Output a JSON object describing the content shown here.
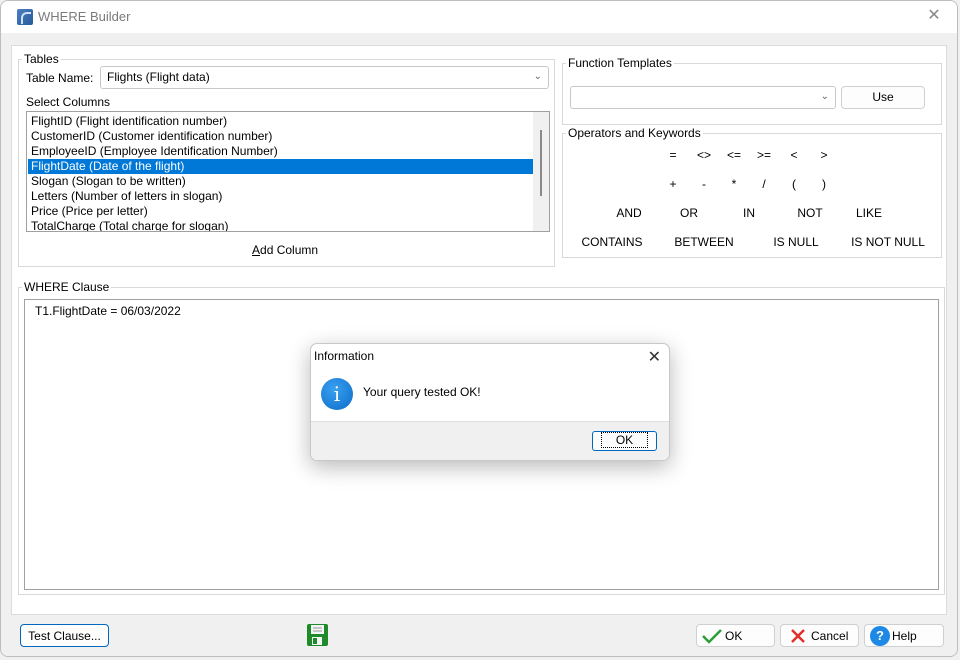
{
  "window": {
    "title": "WHERE Builder",
    "close_icon": "close-icon"
  },
  "tables": {
    "group_label": "Tables",
    "table_name_label": "Table Name:",
    "table_name_value": "Flights  (Flight data)",
    "select_columns_label": "Select Columns",
    "columns": [
      "FlightID  (Flight identification number)",
      "CustomerID  (Customer identification number)",
      "EmployeeID  (Employee Identification Number)",
      "FlightDate  (Date of the flight)",
      "Slogan  (Slogan to be written)",
      "Letters  (Number of letters in slogan)",
      "Price  (Price per letter)",
      "TotalCharge  (Total charge for slogan)"
    ],
    "selected_column": "FlightDate  (Date of the flight)",
    "add_column_label": "Add Column"
  },
  "function_templates": {
    "group_label": "Function Templates",
    "selected_value": "",
    "use_label": "Use"
  },
  "operators": {
    "group_label": "Operators and Keywords",
    "row1": [
      "=",
      "<>",
      "<=",
      ">=",
      "<",
      ">"
    ],
    "row2": [
      "+",
      "-",
      "*",
      "/",
      "(",
      ")"
    ],
    "row3": [
      "AND",
      "OR",
      "IN",
      "NOT",
      "LIKE"
    ],
    "row4": [
      "CONTAINS",
      "BETWEEN",
      "IS NULL",
      "IS NOT NULL"
    ]
  },
  "where_clause": {
    "group_label": "WHERE Clause",
    "text": "T1.FlightDate  = 06/03/2022"
  },
  "footer": {
    "test_clause_label": "Test Clause...",
    "save_icon": "floppy-disk-icon",
    "ok_label": "OK",
    "cancel_label": "Cancel",
    "help_label": "Help"
  },
  "dialog": {
    "title": "Information",
    "message": "Your query tested OK!",
    "ok_label": "OK",
    "icon": "info-icon"
  },
  "colors": {
    "selection": "#0078d7",
    "ok_check": "#2e9e3a",
    "cancel_x": "#e0302a",
    "help_blue": "#1e88e5",
    "save_green": "#1f8a2a"
  }
}
